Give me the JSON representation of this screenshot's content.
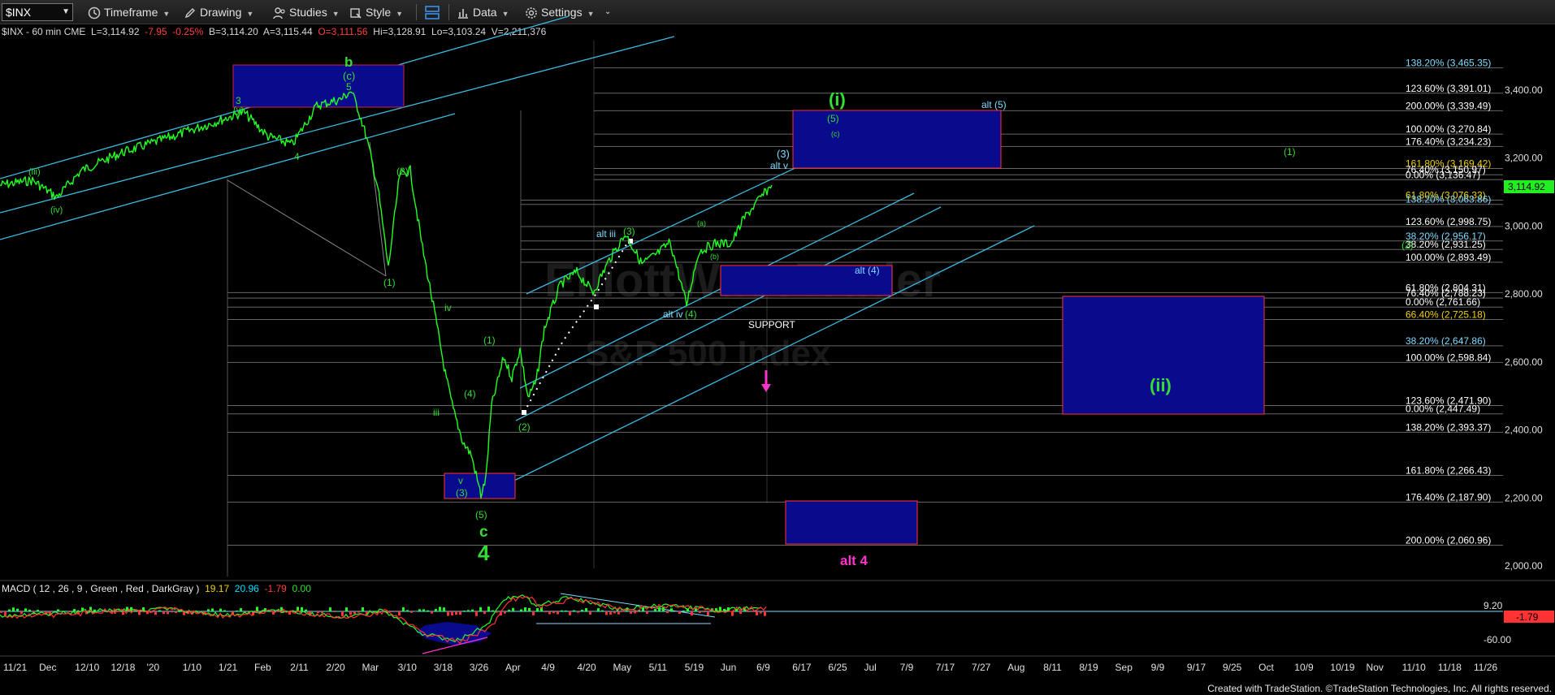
{
  "toolbar": {
    "symbol": "$INX",
    "items": [
      "Timeframe",
      "Drawing",
      "Studies",
      "Style",
      "Data",
      "Settings"
    ]
  },
  "readout": {
    "prefix": "$INX - 60 min CME",
    "last": "L=3,114.92",
    "change": "-7.95",
    "pct": "-0.25%",
    "bid": "B=3,114.20",
    "ask": "A=3,115.44",
    "open": "O=3,111.56",
    "high": "Hi=3,128.91",
    "low": "Lo=3,103.24",
    "vol": "V=2,211,376"
  },
  "macd": {
    "label": "MACD ( 12 , 26 , 9 , Green , Red , DarkGray )",
    "v1": "19.17",
    "v2": "20.96",
    "v3": "-1.79",
    "v4": "0.00",
    "axis_labels": [
      "9.20",
      "-60.00"
    ],
    "marker": "-1.79"
  },
  "price_axis": [
    "3,400.00",
    "3,200.00",
    "3,000.00",
    "2,800.00",
    "2,600.00",
    "2,400.00",
    "2,200.00",
    "2,000.00"
  ],
  "last_price_tag": "3,114.92",
  "date_axis": [
    "11/21",
    "Dec",
    "12/10",
    "12/18",
    "'20",
    "1/10",
    "1/21",
    "Feb",
    "2/11",
    "2/20",
    "Mar",
    "3/10",
    "3/18",
    "3/26",
    "Apr",
    "4/9",
    "4/20",
    "May",
    "5/11",
    "5/19",
    "Jun",
    "6/9",
    "6/17",
    "6/25",
    "Jul",
    "7/9",
    "7/17",
    "7/27",
    "Aug",
    "8/11",
    "8/19",
    "Sep",
    "9/9",
    "9/17",
    "9/25",
    "Oct",
    "10/9",
    "10/19",
    "Nov",
    "11/10",
    "11/18",
    "11/26"
  ],
  "fib_levels": [
    {
      "text": "138.20% (3,465.35)",
      "color": "#7fdcff"
    },
    {
      "text": "123.60% (3,391.01)",
      "color": "#ffffff"
    },
    {
      "text": "200.00% (3,339.49)",
      "color": "#ffffff"
    },
    {
      "text": "100.00% (3,270.84)",
      "color": "#ffffff"
    },
    {
      "text": "176.40% (3,234.23)",
      "color": "#ffffff"
    },
    {
      "text": "161.80% (3,169.42)",
      "color": "#f0d000"
    },
    {
      "text": "76.40% (3,150.97)",
      "color": "#ffffff"
    },
    {
      "text": "0.00% (3,136.47)",
      "color": "#ffffff"
    },
    {
      "text": "61.80% (3,076.33)",
      "color": "#f0d000"
    },
    {
      "text": "138.20% (3,063.86)",
      "color": "#7fdcff"
    },
    {
      "text": "123.60% (2,998.75)",
      "color": "#ffffff"
    },
    {
      "text": "38.20% (2,956.17)",
      "color": "#7fdcff"
    },
    {
      "text": "38.20% (2,931.25)",
      "color": "#ffffff"
    },
    {
      "text": "100.00% (2,893.49)",
      "color": "#ffffff"
    },
    {
      "text": "61.80% (2,804.31)",
      "color": "#ffffff"
    },
    {
      "text": "76.40% (2,788.23)",
      "color": "#ffffff"
    },
    {
      "text": "0.00% (2,761.66)",
      "color": "#ffffff"
    },
    {
      "text": "66.40% (2,725.18)",
      "color": "#f0d000"
    },
    {
      "text": "38.20% (2,647.86)",
      "color": "#7fdcff"
    },
    {
      "text": "100.00% (2,598.84)",
      "color": "#ffffff"
    },
    {
      "text": "123.60% (2,471.90)",
      "color": "#ffffff"
    },
    {
      "text": "0.00% (2,447.49)",
      "color": "#ffffff"
    },
    {
      "text": "138.20% (2,393.37)",
      "color": "#ffffff"
    },
    {
      "text": "161.80% (2,266.43)",
      "color": "#ffffff"
    },
    {
      "text": "176.40% (2,187.90)",
      "color": "#ffffff"
    },
    {
      "text": "200.00% (2,060.96)",
      "color": "#ffffff"
    }
  ],
  "wave_labels": {
    "b": "b",
    "c_top": "(c)",
    "five_top": "5",
    "three_top": "3",
    "y_top": "(y)",
    "four_feb": "4",
    "iii_dec": "(iii)",
    "iv_dec": "(iv)",
    "two_mar": "(2)",
    "one_mar": "(1)",
    "iv_mar": "iv",
    "iii_mar": "iii",
    "v_low": "v",
    "three_low": "(3)",
    "five_low": "(5)",
    "c_low": "c",
    "four_big": "4",
    "one_apr": "(1)",
    "four_apr": "(4)",
    "two_apr": "(2)",
    "alt_iii": "alt iii",
    "three_apr": "(3)",
    "a_may": "(a)",
    "b_may": "(b)",
    "alt_iv": "alt iv",
    "four_may": "(4)",
    "three_jun": "(3)",
    "alt_v": "alt v",
    "i_big": "(i)",
    "five_box": "(5)",
    "c_box": "(c)",
    "alt5": "alt (5)",
    "one_right": "(1)",
    "two_right": "(2)",
    "alt4_blue": "alt (4)",
    "support": "SUPPORT",
    "ii_big": "(ii)",
    "alt4_big": "alt 4"
  },
  "watermark": [
    "ElliottWaveTrader",
    "S&P 500 Index"
  ],
  "colors": {
    "price": "#22ff22",
    "box": "#0a0a8c",
    "box_border_red": "#ff3333",
    "channel": "#3bb9e0",
    "magenta": "#ff33cc"
  },
  "footer": "Created with TradeStation. ©TradeStation Technologies, Inc. All rights reserved."
}
